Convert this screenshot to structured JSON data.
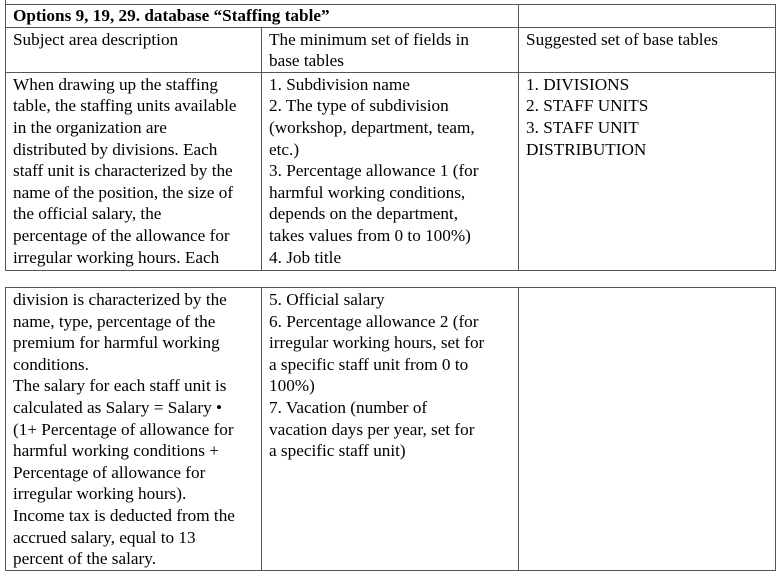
{
  "title": "Options 9, 19, 29. database “Staffing table”",
  "headers": {
    "subject_area": "Subject area description",
    "min_fields": "The minimum set of fields in\nbase tables",
    "base_tables": "Suggested set of base tables"
  },
  "part_1": {
    "subject_area": "When drawing up the staffing\ntable, the staffing units available\nin the organization are\ndistributed by divisions. Each\nstaff unit is characterized by the\nname of the position, the size of\nthe official salary, the\npercentage of the allowance for\nirregular working hours. Each",
    "min_fields": "1. Subdivision name\n2. The type of subdivision\n(workshop, department, team,\netc.)\n3. Percentage allowance 1 (for\nharmful working conditions,\ndepends on the department,\ntakes values from 0 to 100%)\n4. Job title",
    "base_tables": "1. DIVISIONS\n2. STAFF UNITS\n3. STAFF UNIT\nDISTRIBUTION"
  },
  "part_2": {
    "subject_area": "division is characterized by the\nname, type, percentage of the\npremium for harmful working\nconditions.\nThe salary for each staff unit is\ncalculated as Salary = Salary •\n(1+ Percentage of allowance for\nharmful working conditions +\nPercentage of allowance for\nirregular working hours).\nIncome tax is deducted from the\naccrued salary, equal to 13\npercent of the salary.",
    "min_fields": "5. Official salary\n6. Percentage allowance 2 (for\nirregular working hours, set for\na specific staff unit from 0 to\n100%)\n7. Vacation (number of\nvacation days per year, set for\na specific staff unit)",
    "base_tables": ""
  }
}
